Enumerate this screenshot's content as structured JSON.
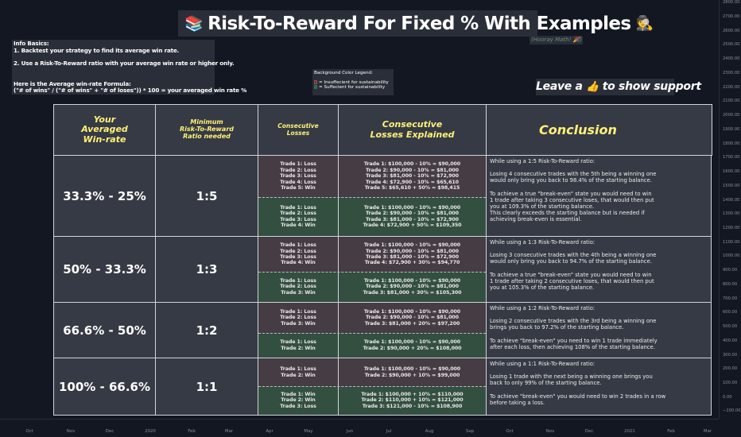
{
  "title": {
    "text": "Risk-To-Reward For Fixed % With Examples",
    "icon_left": "books-icon",
    "icon_right": "detective-icon",
    "subtitle": "(Hooray Math! 🎉)"
  },
  "info": {
    "heading": "Info Basics:",
    "line1": "1. Backtest your strategy to find its average win rate.",
    "line2": "2. Use a Risk-To-Reward ratio with your average win rate or higher only.",
    "formula_heading": "Here is the Average win-rate Formula:",
    "formula": "(\"# of wins\" / (\"# of wins\" + \"# of loses\")) * 100 = your averaged win rate %"
  },
  "legend": {
    "heading": "Background Color Legend:",
    "insufficient": "= Insuffecient for sustainability",
    "sufficient": "= Suffecient for sustainability",
    "insufficient_color": "#463c43",
    "sufficient_color": "#334f40"
  },
  "support": {
    "text_before": "Leave a",
    "icon": "thumbs-up-icon",
    "text_after": "to show support"
  },
  "table": {
    "headers": [
      "Your\nAveraged\nWin-rate",
      "Minimum\nRisk-To-Reward\nRatio needed",
      "Consecutive\nLosses",
      "Consecutive\nLosses Explained",
      "Conclusion"
    ],
    "rows": [
      {
        "winrate": "33.3% - 25%",
        "ratio": "1:5",
        "insufficient": {
          "losses": [
            "Trade 1: Loss",
            "Trade 2: Loss",
            "Trade 3: Loss",
            "Trade 4: Loss",
            "Trade 5: Win"
          ],
          "explained": [
            "Trade 1: $100,000 - 10% = $90,000",
            "Trade 2: $90,000 - 10% = $81,000",
            "Trade 3: $81,000 - 10% = $72,900",
            "Trade 4: $72,900 - 10% = $65,610",
            "Trade 5: $65,610 + 50% = $98,415"
          ]
        },
        "sufficient": {
          "losses": [
            "Trade 1: Loss",
            "Trade 2: Loss",
            "Trade 3: Loss",
            "Trade 4: Win"
          ],
          "explained": [
            "Trade 1: $100,000 - 10% = $90,000",
            "Trade 2: $90,000 - 10% = $81,000",
            "Trade 3: $81,000 - 10% = $72,900",
            "Trade 4: $72,900 + 50% = $109,350"
          ]
        },
        "conclusion": [
          "While using a 1:5 Risk-To-Reward ratio:",
          "",
          "Losing 4 consecutive trades with the 5th being a winning one",
          "would only bring you back to 98.4% of the starting balance.",
          "",
          "To achieve a true \"break-even\" state you would need to win",
          "1 trade after taking 3 consecutive loses, that would then put",
          "you at 109.3% of the starting balance.",
          "This clearly exceeds the starting balance but is needed if",
          "achieving break-even is essential."
        ]
      },
      {
        "winrate": "50% - 33.3%",
        "ratio": "1:3",
        "insufficient": {
          "losses": [
            "Trade 1: Loss",
            "Trade 2: Loss",
            "Trade 3: Loss",
            "Trade 4: Win"
          ],
          "explained": [
            "Trade 1: $100,000 - 10% = $90,000",
            "Trade 2: $90,000 - 10% = $81,000",
            "Trade 3: $81,000 - 10% = $72,900",
            "Trade 4: $72,900 + 30% = $94,770"
          ]
        },
        "sufficient": {
          "losses": [
            "Trade 1: Loss",
            "Trade 2: Loss",
            "Trade 3: Win"
          ],
          "explained": [
            "Trade 1: $100,000 - 10% = $90,000",
            "Trade 2: $90,000 - 10% = $81,000",
            "Trade 3: $81,000 + 30% = $105,300"
          ]
        },
        "conclusion": [
          "While using a 1:3 Risk-To-Reward ratio:",
          "",
          "Losing 3 consecutive trades with the 4th being a winning one",
          "would only bring you back to 94.7% of the starting balance.",
          "",
          "To achieve a true \"break-even\" state you would need to win",
          "1 trade after taking 2 consecutive loses, that would then put",
          "you at 105.3% of the starting balance."
        ]
      },
      {
        "winrate": "66.6% - 50%",
        "ratio": "1:2",
        "insufficient": {
          "losses": [
            "Trade 1: Loss",
            "Trade 2: Loss",
            "Trade 3: Win"
          ],
          "explained": [
            "Trade 1: $100,000 - 10% = $90,000",
            "Trade 2: $90,000 - 10% = $81,000",
            "Trade 3: $81,000 + 20% = $97,200"
          ]
        },
        "sufficient": {
          "losses": [
            "Trade 1: Loss",
            "Trade 2: Win"
          ],
          "explained": [
            "Trade 1: $100,000 - 10% = $90,000",
            "Trade 2: $90,000 + 20% = $108,000"
          ]
        },
        "conclusion": [
          "While using a 1:2 Risk-To-Reward ratio:",
          "",
          "Losing 2 consecutive trades with the 3rd being a winning one",
          "brings you back to 97.2% of the starting balance.",
          "",
          "To achieve \"break-even\" you need to win 1 trade immediately",
          "after each loss, then achieving 108% of the starting balance."
        ]
      },
      {
        "winrate": "100% - 66.6%",
        "ratio": "1:1",
        "insufficient": {
          "losses": [
            "Trade 1: Loss",
            "Trade 2: Win"
          ],
          "explained": [
            "Trade 1: $100,000 - 10% = $90,000",
            "Trade 2: $90,000 + 10% = $99,000"
          ]
        },
        "sufficient": {
          "losses": [
            "Trade 1: Win",
            "Trade 2: Win",
            "Trade 3: Loss"
          ],
          "explained": [
            "Trade 1: $100,000 + 10% = $110,000",
            "Trade 2: $110,000 + 10% = $121,000",
            "Trade 3: $121,000 - 10% = $108,900"
          ]
        },
        "conclusion": [
          "While using a 1:1 Risk-To-Reward ratio:",
          "",
          "Losing 1 trade with the next being a winning one brings you",
          "back to only 99% of the starting balance.",
          "",
          "To achieve \"break-even\" you would need to win 2 trades in a row",
          "before taking a loss."
        ]
      }
    ]
  },
  "price_axis": [
    "2800.00",
    "2700.00",
    "2600.00",
    "2500.00",
    "2400.00",
    "2300.00",
    "2200.00",
    "2100.00",
    "2000.00",
    "1900.00",
    "1800.00",
    "1700.00",
    "1600.00",
    "1500.00",
    "1400.00",
    "1300.00",
    "1200.00",
    "1100.00",
    "1000.00",
    "900.00",
    "800.00",
    "700.00",
    "600.00",
    "500.00",
    "400.00",
    "300.00",
    "200.00",
    "100.00",
    "0.00",
    "−100.00"
  ],
  "time_axis": [
    "Oct",
    "Nov",
    "Dec",
    "2020",
    "Feb",
    "Mar",
    "Apr",
    "May",
    "Jun",
    "Jul",
    "Aug",
    "Sep",
    "Oct",
    "Nov",
    "Dec",
    "2021",
    "Feb",
    "Mar"
  ]
}
